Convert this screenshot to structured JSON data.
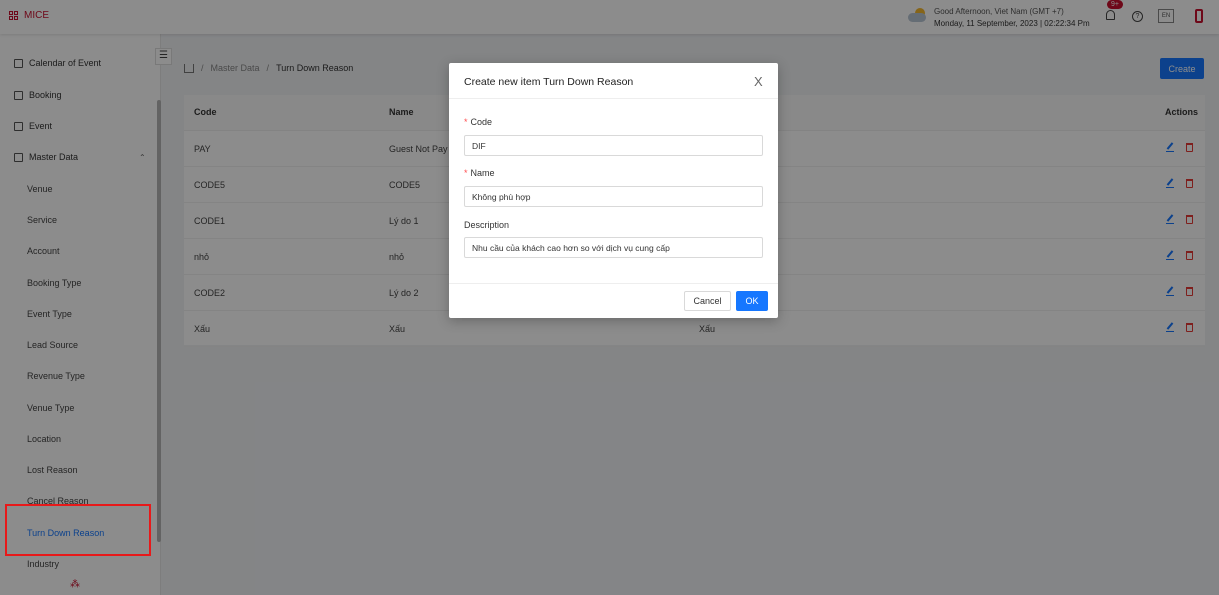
{
  "header": {
    "app_name": "MICE",
    "greeting": "Good Afternoon, Viet Nam (GMT +7)",
    "datetime": "Monday, 11 September, 2023 | 02:22:34 Pm",
    "notification_badge": "9+",
    "help_symbol": "?",
    "language": "EN"
  },
  "sidebar": {
    "items": [
      {
        "label": "Calendar of Event",
        "icon": "calendar-icon"
      },
      {
        "label": "Booking",
        "icon": "booking-icon"
      },
      {
        "label": "Event",
        "icon": "event-icon"
      },
      {
        "label": "Master Data",
        "icon": "master-data-icon"
      }
    ],
    "sub_items": [
      "Venue",
      "Service",
      "Account",
      "Booking Type",
      "Event Type",
      "Lead Source",
      "Revenue Type",
      "Venue Type",
      "Location",
      "Lost Reason",
      "Cancel Reason",
      "Turn Down Reason",
      "Industry"
    ],
    "active_sub_item": "Turn Down Reason"
  },
  "breadcrumb": {
    "parent": "Master Data",
    "current": "Turn Down Reason",
    "separator": "/"
  },
  "toolbar": {
    "create_label": "Create"
  },
  "table": {
    "headers": {
      "code": "Code",
      "name": "Name",
      "actions": "Actions"
    },
    "rows": [
      {
        "code": "PAY",
        "name": "Guest Not Pay",
        "description": ""
      },
      {
        "code": "CODE5",
        "name": "CODE5",
        "description": ""
      },
      {
        "code": "CODE1",
        "name": "Lý do 1",
        "description": ""
      },
      {
        "code": "nhỏ",
        "name": "nhỏ",
        "description": ""
      },
      {
        "code": "CODE2",
        "name": "Lý do 2",
        "description": ""
      },
      {
        "code": "Xấu",
        "name": "Xấu",
        "description": "Xấu"
      }
    ]
  },
  "modal": {
    "title": "Create new item Turn Down Reason",
    "close_symbol": "X",
    "fields": {
      "code": {
        "label": "Code",
        "required": true,
        "value": "DIF"
      },
      "name": {
        "label": "Name",
        "required": true,
        "value": "Không phù hợp"
      },
      "description": {
        "label": "Description",
        "required": false,
        "value": "Nhu cầu của khách cao hơn so với dịch vụ cung cấp"
      }
    },
    "required_mark": "*",
    "cancel_label": "Cancel",
    "ok_label": "OK"
  },
  "colors": {
    "brand": "#c8102e",
    "primary": "#1677ff",
    "danger": "#e53935",
    "highlight_box": "#e8191a"
  }
}
